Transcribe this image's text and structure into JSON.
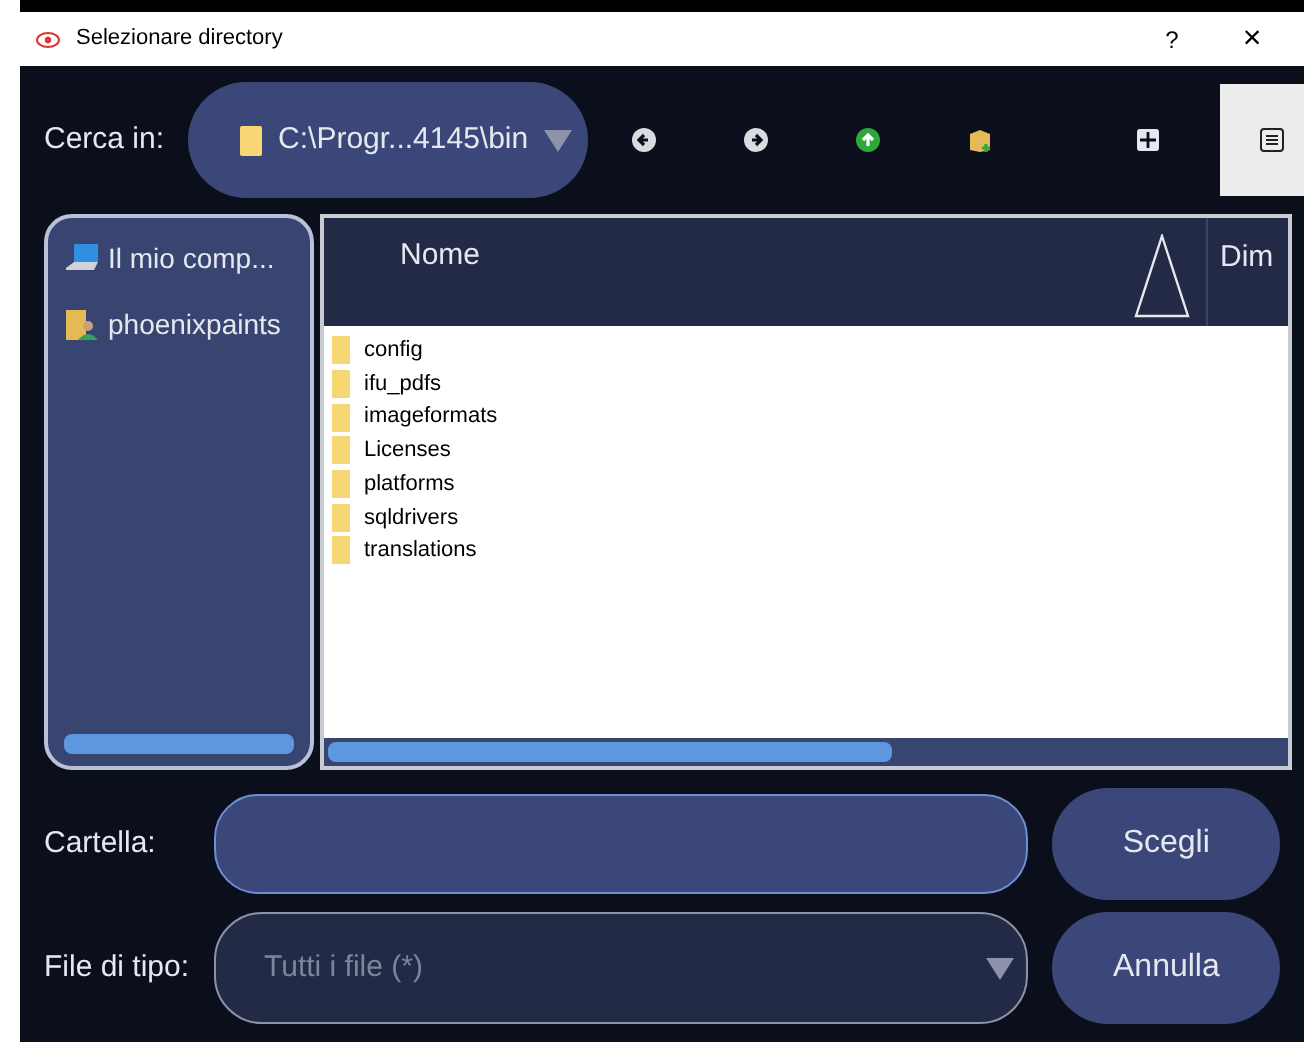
{
  "window": {
    "title": "Selezionare directory",
    "help": "?",
    "close": "×"
  },
  "toolbar": {
    "look_in_label": "Cerca in:",
    "path": "C:\\Progr...4145\\bin",
    "nav_buttons": [
      {
        "kind": "back"
      },
      {
        "kind": "forward"
      },
      {
        "kind": "up"
      },
      {
        "kind": "new_folder"
      }
    ],
    "view_modes": [
      {
        "kind": "list",
        "selected": false
      },
      {
        "kind": "detail",
        "selected": true
      }
    ]
  },
  "sidebar": {
    "items": [
      {
        "kind": "computer",
        "label": "Il mio comp..."
      },
      {
        "kind": "user",
        "label": "phoenixpaints"
      }
    ]
  },
  "file_list": {
    "columns": [
      {
        "label": "Nome",
        "sorted": true
      },
      {
        "label": "Dim",
        "sorted": false
      }
    ],
    "rows": [
      "config",
      "ifu_pdfs",
      "imageformats",
      "Licenses",
      "platforms",
      "sqldrivers",
      "translations"
    ]
  },
  "folder": {
    "label": "Cartella:"
  },
  "file_type": {
    "label": "File di tipo:",
    "value": "Tutti i file (*)",
    "disabled": true
  },
  "buttons": [
    "Scegli",
    "Annulla"
  ]
}
